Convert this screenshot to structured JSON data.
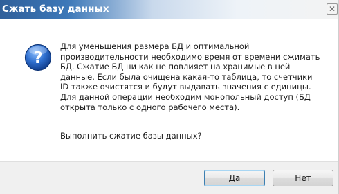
{
  "dialog": {
    "title": "Сжать базу данных",
    "close_glyph": "✕",
    "icon": "question-icon",
    "message": "Для уменьшения размера БД и оптимальной\nпроизводительности необходимо время от времени сжимать\nБД. Сжатие БД ни как не повлияет на хранимые в ней\nданные. Если была очищена какая-то таблица, то счетчики\nID также очистятся и будут выдавать значения с единицы.\nДля данной операции необходим монопольный доступ (БД\nоткрыта только с одного рабочего места).",
    "question": "Выполнить сжатие базы данных?",
    "buttons": {
      "yes_label": "Да",
      "no_label": "Нет"
    }
  },
  "colors": {
    "titlebar_start": "#2f5f9a",
    "icon_blue": "#2f6fcf",
    "footer_bg": "#f0f0f0"
  }
}
